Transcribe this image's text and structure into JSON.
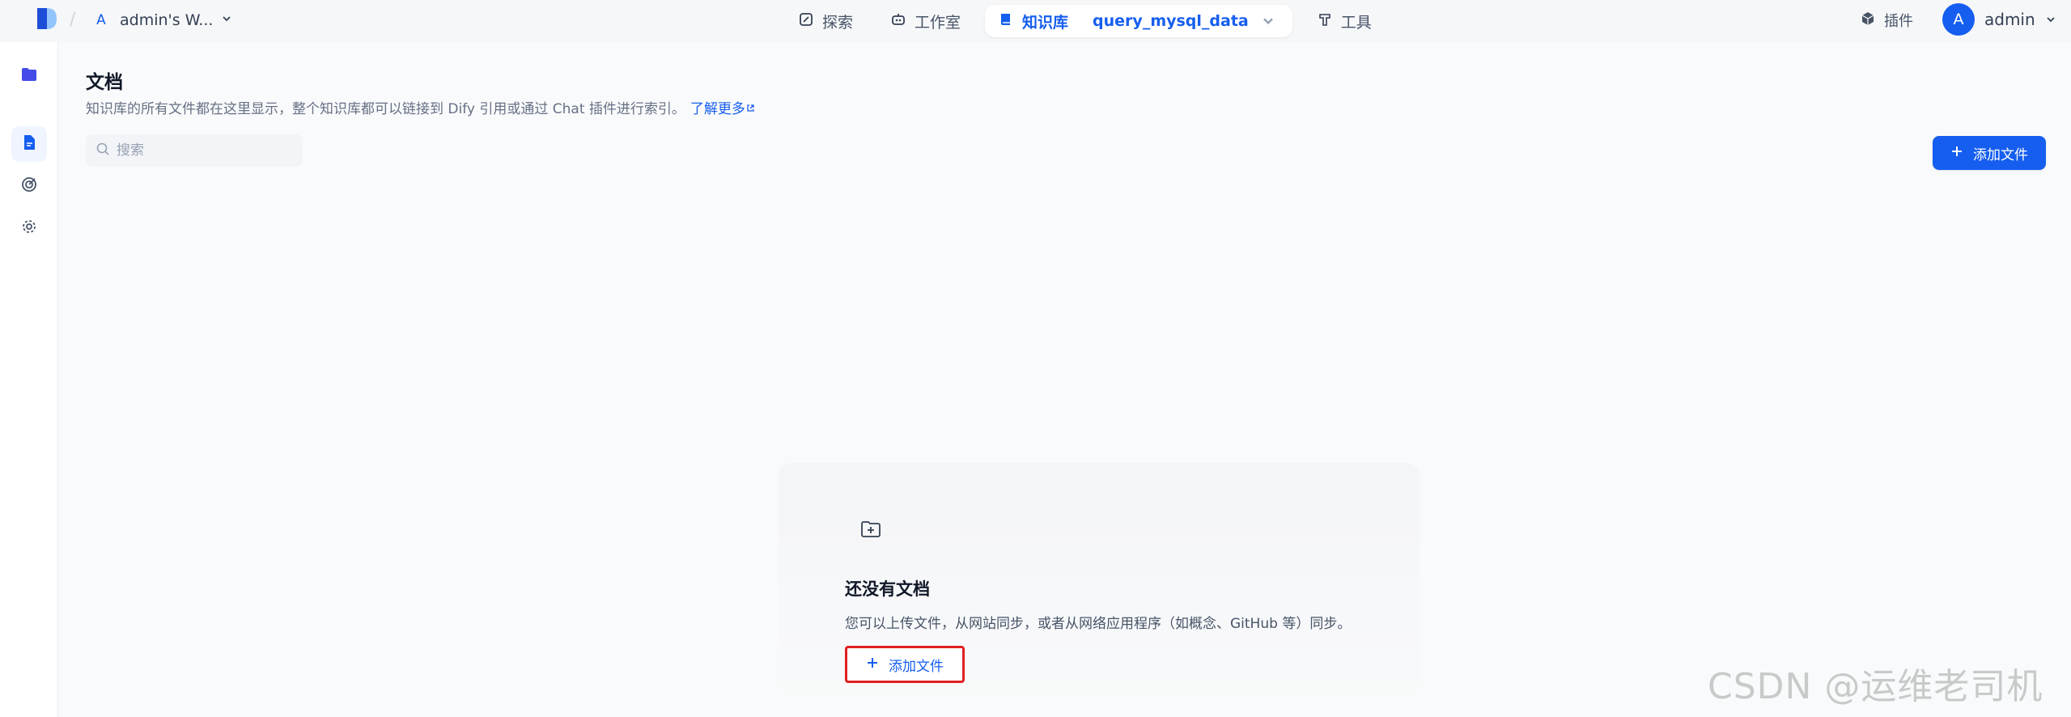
{
  "workspace": {
    "initial": "A",
    "name": "admin's W..."
  },
  "nav": {
    "explore": "探索",
    "studio": "工作室",
    "knowledge": "知识库",
    "dataset_name": "query_mysql_data",
    "tools": "工具"
  },
  "header_right": {
    "plugins": "插件",
    "avatar_initial": "A",
    "username": "admin"
  },
  "page": {
    "title": "文档",
    "description": "知识库的所有文件都在这里显示，整个知识库都可以链接到 Dify 引用或通过 Chat 插件进行索引。",
    "learn_more": "了解更多",
    "search_placeholder": "搜索",
    "add_file": "添加文件"
  },
  "empty_state": {
    "title": "还没有文档",
    "description": "您可以上传文件，从网站同步，或者从网络应用程序（如概念、GitHub 等）同步。",
    "add_file": "添加文件"
  },
  "watermark": "CSDN @运维老司机",
  "colors": {
    "accent": "#155eef",
    "highlight_box": "#e02020"
  }
}
